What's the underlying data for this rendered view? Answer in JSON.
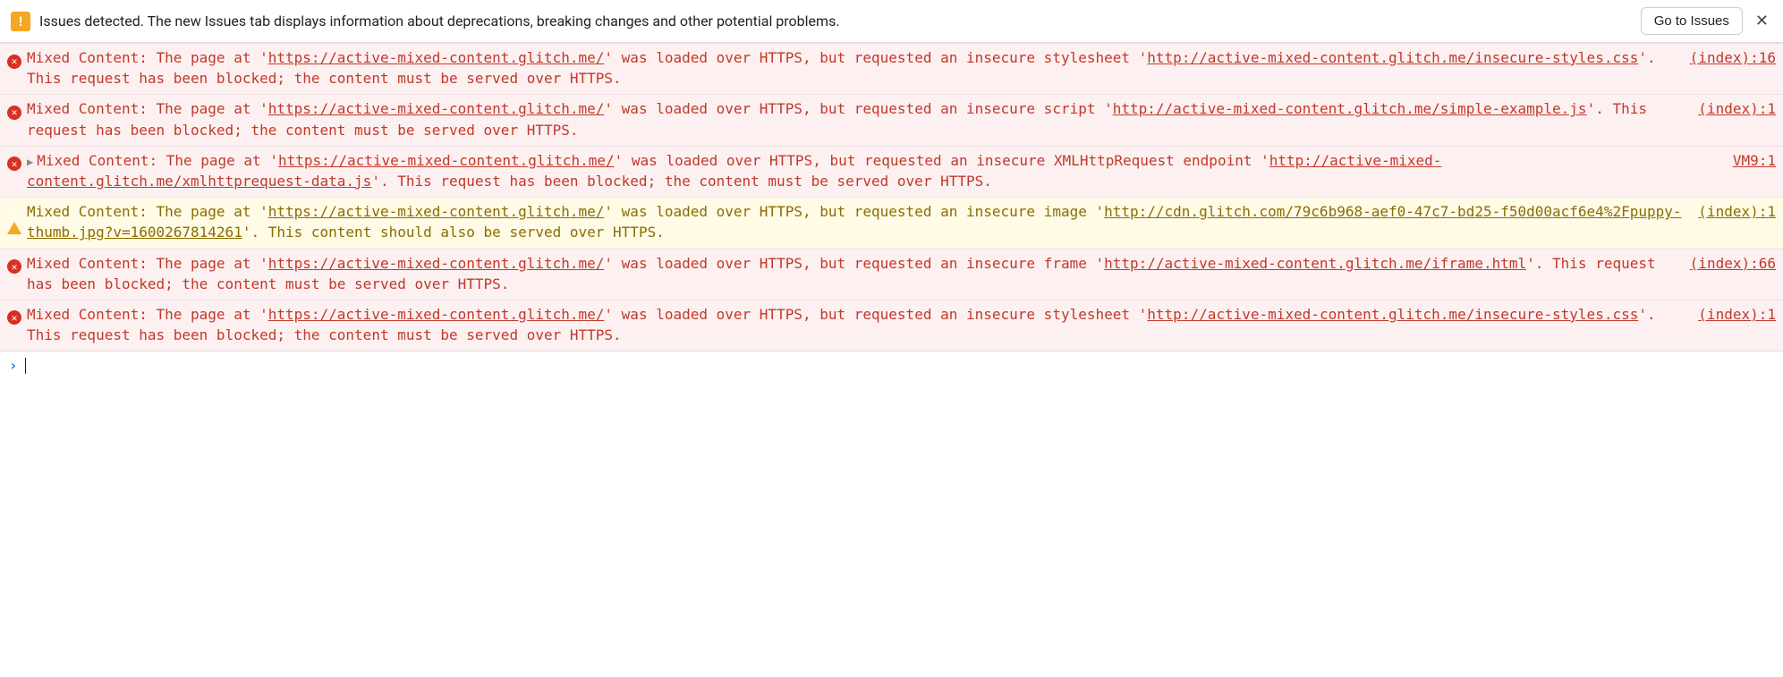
{
  "header": {
    "issues_text": "Issues detected. The new Issues tab displays information about deprecations, breaking changes and other potential problems.",
    "go_to_issues": "Go to Issues",
    "close": "✕"
  },
  "messages": [
    {
      "level": "error",
      "expandable": false,
      "parts": [
        {
          "t": "text",
          "v": "Mixed Content: The page at '"
        },
        {
          "t": "link",
          "v": "https://active-mixed-content.glitch.me/"
        },
        {
          "t": "text",
          "v": "' was loaded over HTTPS, but requested an insecure stylesheet '"
        },
        {
          "t": "link",
          "v": "http://active-mixed-content.glitch.me/insecure-styles.css"
        },
        {
          "t": "text",
          "v": "'. This request has been blocked; the content must be served over HTTPS."
        }
      ],
      "source": "(index):16"
    },
    {
      "level": "error",
      "expandable": false,
      "parts": [
        {
          "t": "text",
          "v": "Mixed Content: The page at '"
        },
        {
          "t": "link",
          "v": "https://active-mixed-content.glitch.me/"
        },
        {
          "t": "text",
          "v": "' was loaded over HTTPS, but requested an insecure script '"
        },
        {
          "t": "link",
          "v": "http://active-mixed-content.glitch.me/simple-example.js"
        },
        {
          "t": "text",
          "v": "'. This request has been blocked; the content must be served over HTTPS."
        }
      ],
      "source": "(index):1"
    },
    {
      "level": "error",
      "expandable": true,
      "parts": [
        {
          "t": "text",
          "v": "Mixed Content: The page at '"
        },
        {
          "t": "link",
          "v": "https://active-mixed-content.glitch.me/"
        },
        {
          "t": "text",
          "v": "' was loaded over HTTPS, but requested an insecure XMLHttpRequest endpoint '"
        },
        {
          "t": "link",
          "v": "http://active-mixed-content.glitch.me/xmlhttprequest-data.js"
        },
        {
          "t": "text",
          "v": "'. This request has been blocked; the content must be served over HTTPS."
        }
      ],
      "source": "VM9:1"
    },
    {
      "level": "warning",
      "expandable": false,
      "parts": [
        {
          "t": "text",
          "v": "Mixed Content: The page at '"
        },
        {
          "t": "link",
          "v": "https://active-mixed-content.glitch.me/"
        },
        {
          "t": "text",
          "v": "' was loaded over HTTPS, but requested an insecure image '"
        },
        {
          "t": "link",
          "v": "http://cdn.glitch.com/79c6b968-aef0-47c7-bd25-f50d00acf6e4%2Fpuppy-thumb.jpg?v=1600267814261"
        },
        {
          "t": "text",
          "v": "'. This content should also be served over HTTPS."
        }
      ],
      "source": "(index):1"
    },
    {
      "level": "error",
      "expandable": false,
      "parts": [
        {
          "t": "text",
          "v": "Mixed Content: The page at '"
        },
        {
          "t": "link",
          "v": "https://active-mixed-content.glitch.me/"
        },
        {
          "t": "text",
          "v": "' was loaded over HTTPS, but requested an insecure frame '"
        },
        {
          "t": "link",
          "v": "http://active-mixed-content.glitch.me/iframe.html"
        },
        {
          "t": "text",
          "v": "'. This request has been blocked; the content must be served over HTTPS."
        }
      ],
      "source": "(index):66"
    },
    {
      "level": "error",
      "expandable": false,
      "parts": [
        {
          "t": "text",
          "v": "Mixed Content: The page at '"
        },
        {
          "t": "link",
          "v": "https://active-mixed-content.glitch.me/"
        },
        {
          "t": "text",
          "v": "' was loaded over HTTPS, but requested an insecure stylesheet '"
        },
        {
          "t": "link",
          "v": "http://active-mixed-content.glitch.me/insecure-styles.css"
        },
        {
          "t": "text",
          "v": "'. This request has been blocked; the content must be served over HTTPS."
        }
      ],
      "source": "(index):1"
    }
  ],
  "prompt": {
    "caret": "›"
  }
}
